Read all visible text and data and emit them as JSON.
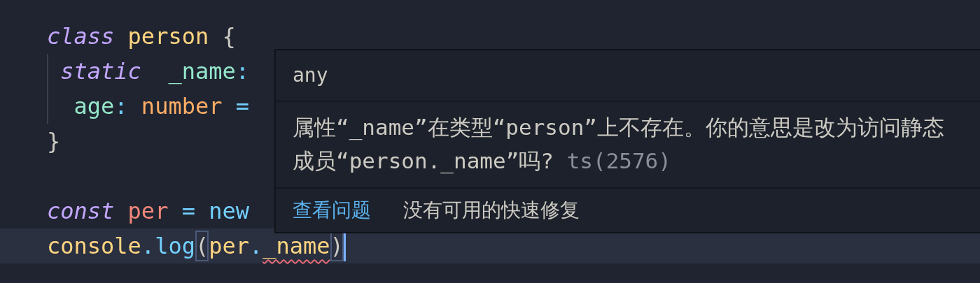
{
  "editor": {
    "lines": [
      {
        "current": false,
        "guide": false,
        "tokens": [
          {
            "kind": "keyword",
            "text": "class"
          },
          {
            "kind": "class",
            "text": " person"
          },
          {
            "kind": "plain",
            "text": " {"
          }
        ]
      },
      {
        "current": false,
        "guide": true,
        "tokens": [
          {
            "kind": "keyword",
            "text": " static"
          },
          {
            "kind": "property",
            "text": "  _name"
          },
          {
            "kind": "operator",
            "text": ":"
          }
        ]
      },
      {
        "current": false,
        "guide": true,
        "tokens": [
          {
            "kind": "property",
            "text": "  age"
          },
          {
            "kind": "operator",
            "text": ":"
          },
          {
            "kind": "type",
            "text": " number"
          },
          {
            "kind": "operator",
            "text": " ="
          }
        ]
      },
      {
        "current": false,
        "guide": false,
        "tokens": [
          {
            "kind": "plain",
            "text": "}"
          }
        ]
      },
      {
        "current": false,
        "guide": false
      },
      {
        "current": false,
        "guide": false,
        "tokens": [
          {
            "kind": "keyword",
            "text": "const"
          },
          {
            "kind": "variable",
            "text": " per"
          },
          {
            "kind": "operator",
            "text": " ="
          },
          {
            "kind": "operator",
            "text": " new"
          }
        ]
      },
      {
        "current": true,
        "guide": false,
        "tokens": [
          {
            "kind": "class",
            "text": "console"
          },
          {
            "kind": "operator",
            "text": "."
          },
          {
            "kind": "function",
            "text": "log"
          },
          {
            "kind": "plain",
            "text": "(",
            "matched": true
          },
          {
            "kind": "class",
            "text": "per"
          },
          {
            "kind": "operator",
            "text": "."
          },
          {
            "kind": "class",
            "text": "_name",
            "error": true
          },
          {
            "kind": "plain",
            "text": ")",
            "matched": true
          }
        ]
      }
    ]
  },
  "hover": {
    "type": "any",
    "message": "属性“_name”在类型“person”上不存在。你的意思是改为访问静态成员“person._name”吗?",
    "code": "ts(2576)",
    "actions": [
      {
        "kind": "link",
        "text": "查看问题"
      },
      {
        "kind": "note",
        "text": "没有可用的快速修复"
      }
    ]
  }
}
